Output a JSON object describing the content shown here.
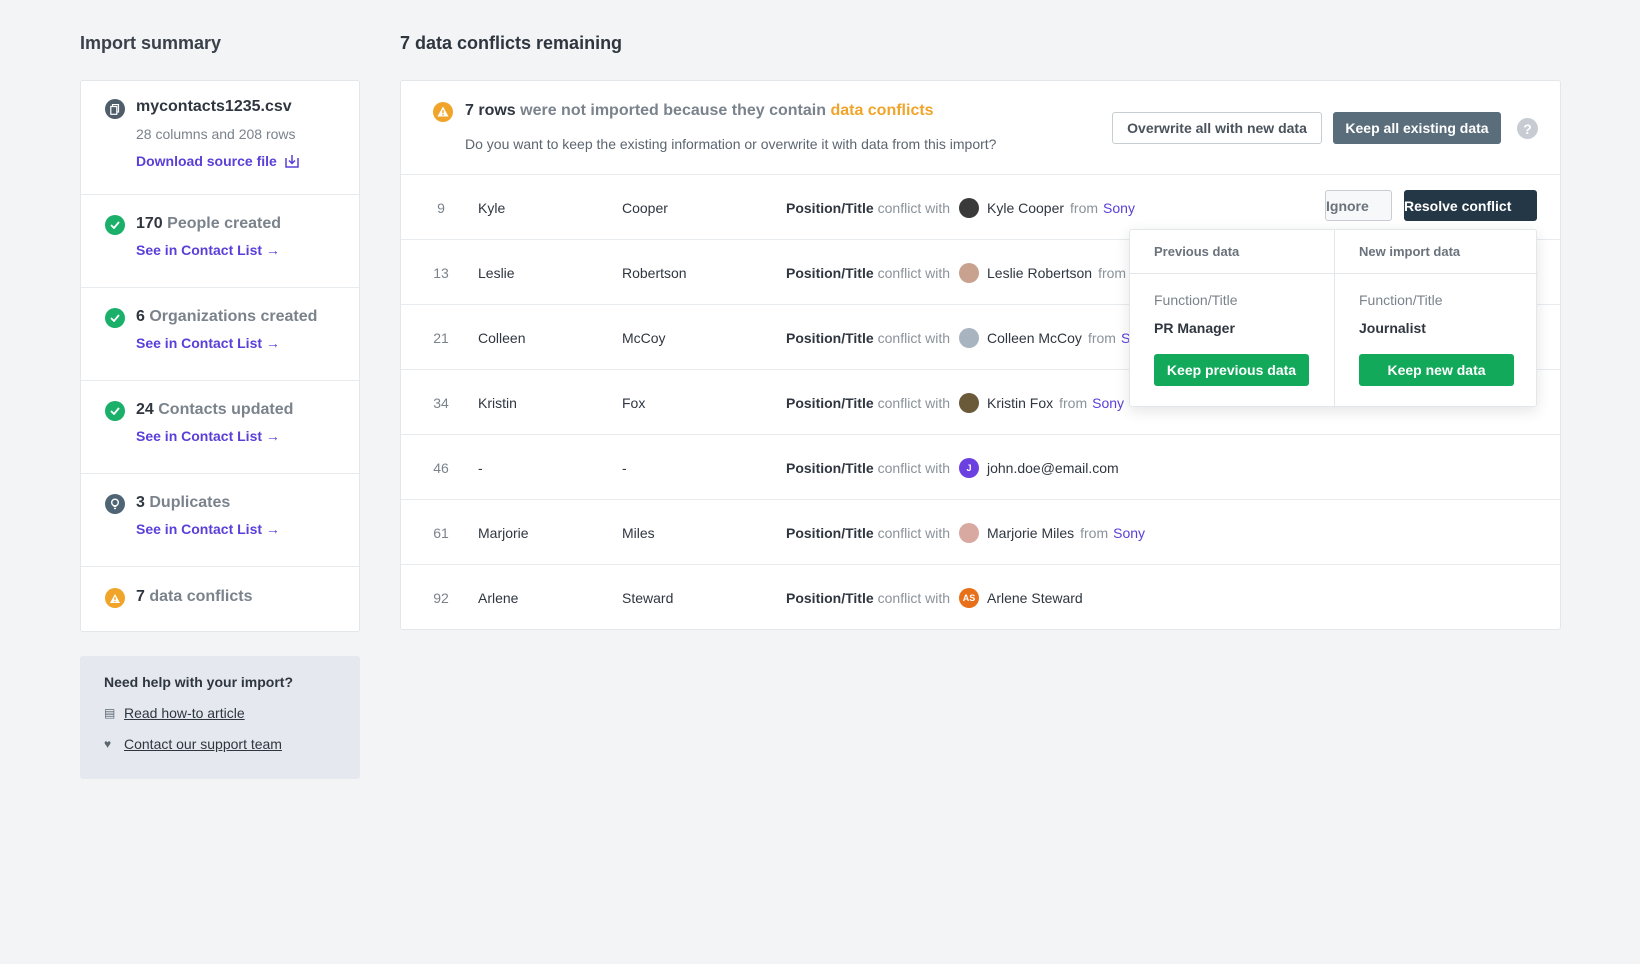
{
  "sidebar": {
    "title": "Import summary",
    "file": {
      "name": "mycontacts1235.csv",
      "meta": "28 columns and 208 rows",
      "download": "Download source file"
    },
    "stats": [
      {
        "num": "170",
        "label": "People created",
        "link": "See in Contact List →",
        "icon": "check-icon"
      },
      {
        "num": "6",
        "label": "Organizations created",
        "link": "See in Contact List →",
        "icon": "check-icon"
      },
      {
        "num": "24",
        "label": "Contacts updated",
        "link": "See in Contact List →",
        "icon": "check-icon"
      },
      {
        "num": "3",
        "label": "Duplicates",
        "link": "See in Contact List →",
        "icon": "lightbulb-icon"
      }
    ],
    "conflicts": {
      "num": "7",
      "label": "data conflicts"
    },
    "help": {
      "title": "Need help with your import?",
      "article": "Read how-to article",
      "support": "Contact our support team"
    }
  },
  "main": {
    "title": "7 data conflicts remaining",
    "notice": {
      "rows": "7 rows",
      "text": "were not imported because they contain",
      "highlight": "data conflicts",
      "question": "Do you want to keep the existing information or overwrite it with data from this import?",
      "overwrite_btn": "Overwrite all with new data",
      "keep_btn": "Keep all existing data",
      "help": "?"
    },
    "conflict_field": "Position/Title",
    "conflict_with": "conflict with",
    "from_label": "from",
    "ignore_btn": "Ignore",
    "resolve_btn": "Resolve conflict",
    "rows": [
      {
        "num": "9",
        "first": "Kyle",
        "last": "Cooper",
        "contact": "Kyle Cooper",
        "from": "from",
        "company": "Sony",
        "avatar": "",
        "avatar_color": "#3a3a3a"
      },
      {
        "num": "13",
        "first": "Leslie",
        "last": "Robertson",
        "contact": "Leslie Robertson",
        "from": "from",
        "company": "",
        "avatar": "",
        "avatar_color": "#c9a28f"
      },
      {
        "num": "21",
        "first": "Colleen",
        "last": "McCoy",
        "contact": "Colleen McCoy",
        "from": "from",
        "company": "S",
        "avatar": "",
        "avatar_color": "#a8b4bf"
      },
      {
        "num": "34",
        "first": "Kristin",
        "last": "Fox",
        "contact": "Kristin Fox",
        "from": "from",
        "company": "Sony",
        "avatar": "",
        "avatar_color": "#6b5a3a"
      },
      {
        "num": "46",
        "first": "-",
        "last": "-",
        "contact": "john.doe@email.com",
        "from": "",
        "company": "",
        "avatar": "J",
        "avatar_color": "#6c3fe0"
      },
      {
        "num": "61",
        "first": "Marjorie",
        "last": "Miles",
        "contact": "Marjorie Miles",
        "from": "from",
        "company": "Sony",
        "avatar": "",
        "avatar_color": "#d8a9a0"
      },
      {
        "num": "92",
        "first": "Arlene",
        "last": "Steward",
        "contact": "Arlene Steward",
        "from": "",
        "company": "",
        "avatar": "AS",
        "avatar_color": "#e8701a"
      }
    ],
    "popover": {
      "prev_header": "Previous data",
      "new_header": "New import data",
      "field": "Function/Title",
      "prev_value": "PR Manager",
      "new_value": "Journalist",
      "keep_prev": "Keep previous data",
      "keep_new": "Keep new data"
    }
  }
}
